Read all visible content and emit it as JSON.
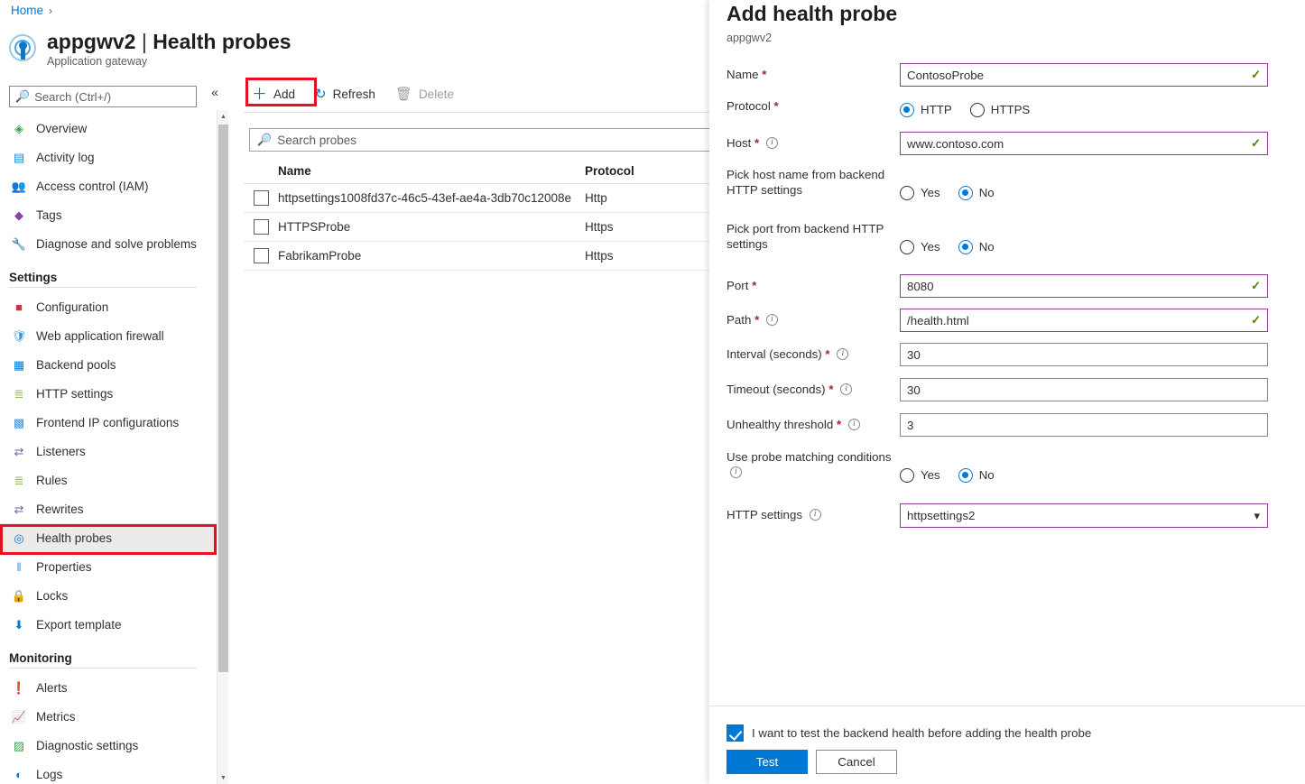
{
  "breadcrumb": {
    "home": "Home",
    "chevron": "›"
  },
  "resource": {
    "name": "appgwv2",
    "separator": "|",
    "section": "Health probes",
    "type": "Application gateway",
    "icon": "application-gateway-icon"
  },
  "sidebar": {
    "search_placeholder": "Search (Ctrl+/)",
    "collapse_glyph": "«",
    "items": [
      {
        "label": "Overview",
        "icon": "overview-icon",
        "glyph": "◈",
        "color": "#3ea34d",
        "selected": false
      },
      {
        "label": "Activity log",
        "icon": "activity-log-icon",
        "glyph": "▤",
        "color": "#1e8bcd",
        "selected": false
      },
      {
        "label": "Access control (IAM)",
        "icon": "access-control-icon",
        "glyph": "ඞ",
        "color": "#0078d4",
        "selected": false
      },
      {
        "label": "Tags",
        "icon": "tags-icon",
        "glyph": "◆",
        "color": "#8a3fa8",
        "selected": false
      },
      {
        "label": "Diagnose and solve problems",
        "icon": "wrench-icon",
        "glyph": "⚒",
        "color": "#4a5a6a",
        "selected": false
      }
    ],
    "groups": [
      {
        "title": "Settings",
        "items": [
          {
            "label": "Configuration",
            "icon": "toolbox-icon",
            "glyph": "▬",
            "color": "#d13438",
            "selected": false
          },
          {
            "label": "Web application firewall",
            "icon": "shield-icon",
            "glyph": "⛨",
            "color": "#3a96dd",
            "selected": false
          },
          {
            "label": "Backend pools",
            "icon": "backend-pools-icon",
            "glyph": "▦",
            "color": "#0078d4",
            "selected": false
          },
          {
            "label": "HTTP settings",
            "icon": "http-settings-icon",
            "glyph": "≣",
            "color": "#8cbf3f",
            "selected": false
          },
          {
            "label": "Frontend IP configurations",
            "icon": "frontend-ip-icon",
            "glyph": "▭",
            "color": "#3a96dd",
            "selected": false
          },
          {
            "label": "Listeners",
            "icon": "listeners-icon",
            "glyph": "⇄",
            "color": "#7a5aa8",
            "selected": false
          },
          {
            "label": "Rules",
            "icon": "rules-icon",
            "glyph": "≣",
            "color": "#8cbf3f",
            "selected": false
          },
          {
            "label": "Rewrites",
            "icon": "rewrites-icon",
            "glyph": "⇄",
            "color": "#7a5aa8",
            "selected": false
          },
          {
            "label": "Health probes",
            "icon": "health-probes-icon",
            "glyph": "◎",
            "color": "#0078d4",
            "selected": true
          },
          {
            "label": "Properties",
            "icon": "properties-icon",
            "glyph": "‖",
            "color": "#3a96dd",
            "selected": false
          },
          {
            "label": "Locks",
            "icon": "lock-icon",
            "glyph": "⚿",
            "color": "#0078d4",
            "selected": false
          },
          {
            "label": "Export template",
            "icon": "export-template-icon",
            "glyph": "⬇",
            "color": "#0078d4",
            "selected": false
          }
        ]
      },
      {
        "title": "Monitoring",
        "items": [
          {
            "label": "Alerts",
            "icon": "alerts-icon",
            "glyph": "❗",
            "color": "#6bb22e",
            "selected": false
          },
          {
            "label": "Metrics",
            "icon": "metrics-icon",
            "glyph": "▮",
            "color": "#3a96dd",
            "selected": false
          },
          {
            "label": "Diagnostic settings",
            "icon": "diagnostic-settings-icon",
            "glyph": "▨",
            "color": "#3ea34d",
            "selected": false
          },
          {
            "label": "Logs",
            "icon": "logs-icon",
            "glyph": "◐",
            "color": "#0078d4",
            "selected": false
          }
        ]
      }
    ]
  },
  "toolbar": {
    "add_label": "Add",
    "add_glyph": "＋",
    "refresh_label": "Refresh",
    "refresh_glyph": "↻",
    "delete_label": "Delete",
    "delete_glyph": "🗑"
  },
  "probe_list": {
    "search_placeholder": "Search probes",
    "columns": [
      "Name",
      "Protocol"
    ],
    "rows": [
      {
        "name": "httpsettings1008fd37c-46c5-43ef-ae4a-3db70c12008e",
        "protocol": "Http"
      },
      {
        "name": "HTTPSProbe",
        "protocol": "Https"
      },
      {
        "name": "FabrikamProbe",
        "protocol": "Https"
      }
    ]
  },
  "panel": {
    "title": "Add health probe",
    "subtitle": "appgwv2",
    "fields": {
      "name": {
        "label": "Name",
        "required": true,
        "value": "ContosoProbe",
        "valid": true
      },
      "protocol": {
        "label": "Protocol",
        "required": true,
        "options": [
          "HTTP",
          "HTTPS"
        ],
        "selected": "HTTP"
      },
      "host": {
        "label": "Host",
        "required": true,
        "info": true,
        "value": "www.contoso.com",
        "valid": true
      },
      "pick_host": {
        "label": "Pick host name from backend HTTP settings",
        "options": [
          "Yes",
          "No"
        ],
        "selected": "No"
      },
      "pick_port": {
        "label": "Pick port from backend HTTP settings",
        "options": [
          "Yes",
          "No"
        ],
        "selected": "No"
      },
      "port": {
        "label": "Port",
        "required": true,
        "value": "8080",
        "valid": true
      },
      "path": {
        "label": "Path",
        "required": true,
        "info": true,
        "value": "/health.html",
        "valid": true
      },
      "interval": {
        "label": "Interval (seconds)",
        "required": true,
        "info": true,
        "value": "30",
        "valid": false
      },
      "timeout": {
        "label": "Timeout (seconds)",
        "required": true,
        "info": true,
        "value": "30",
        "valid": false
      },
      "unhealthy": {
        "label": "Unhealthy threshold",
        "required": true,
        "info": true,
        "value": "3",
        "valid": false
      },
      "matching": {
        "label": "Use probe matching conditions",
        "info": true,
        "options": [
          "Yes",
          "No"
        ],
        "selected": "No"
      },
      "http_settings": {
        "label": "HTTP settings",
        "info": true,
        "value": "httpsettings2",
        "chevron": "⌄"
      }
    },
    "footer": {
      "checkbox_label": "I want to test the backend health before adding the health probe",
      "checkbox_checked": true,
      "test_label": "Test",
      "cancel_label": "Cancel"
    }
  },
  "colors": {
    "accent": "#0078d4",
    "valid_border": "#8f3f97",
    "check_green": "#498205",
    "required_red": "#a4262c",
    "highlight_red": "#e81123"
  }
}
